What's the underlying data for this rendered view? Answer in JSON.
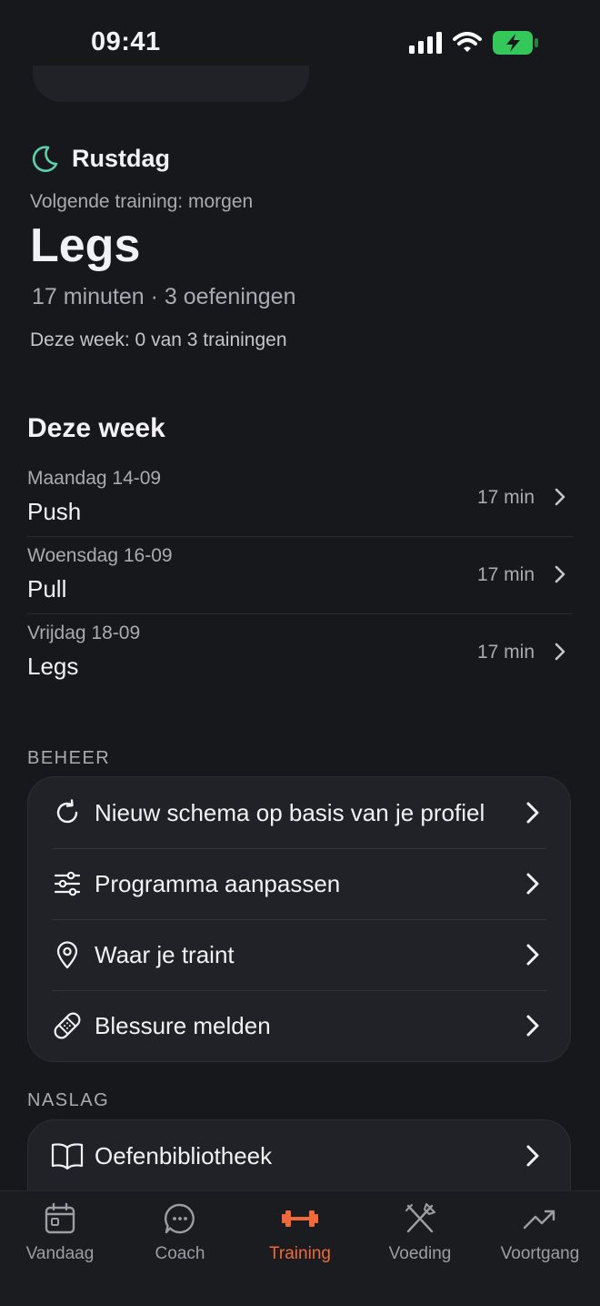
{
  "status_bar": {
    "time": "09:41"
  },
  "today": {
    "status": "Rustdag",
    "next_training": "Volgende training: morgen",
    "workout_name": "Legs",
    "workout_meta": "17 minuten · 3 oefeningen",
    "week_progress": "Deze week: 0 van 3 trainingen"
  },
  "week": {
    "title": "Deze week",
    "items": [
      {
        "date": "Maandag 14-09",
        "name": "Push",
        "duration": "17 min"
      },
      {
        "date": "Woensdag 16-09",
        "name": "Pull",
        "duration": "17 min"
      },
      {
        "date": "Vrijdag 18-09",
        "name": "Legs",
        "duration": "17 min"
      }
    ]
  },
  "manage": {
    "label": "BEHEER",
    "items": [
      {
        "label": "Nieuw schema op basis van je profiel",
        "icon": "refresh-icon"
      },
      {
        "label": "Programma aanpassen",
        "icon": "sliders-icon"
      },
      {
        "label": "Waar je traint",
        "icon": "location-pin-icon"
      },
      {
        "label": "Blessure melden",
        "icon": "bandage-icon"
      }
    ]
  },
  "reference": {
    "label": "NASLAG",
    "items": [
      {
        "label": "Oefenbibliotheek",
        "icon": "book-icon"
      }
    ]
  },
  "tab_bar": {
    "active": "Training",
    "accent_color": "#f0693a",
    "tabs": [
      {
        "label": "Vandaag",
        "icon": "calendar-icon"
      },
      {
        "label": "Coach",
        "icon": "chat-bubble-icon"
      },
      {
        "label": "Training",
        "icon": "dumbbell-icon"
      },
      {
        "label": "Voeding",
        "icon": "fork-knife-icon"
      },
      {
        "label": "Voortgang",
        "icon": "trend-up-icon"
      }
    ]
  },
  "colors": {
    "background": "#17181c",
    "card": "#212227",
    "rest_icon": "#5fd0a5",
    "battery": "#34c759"
  }
}
